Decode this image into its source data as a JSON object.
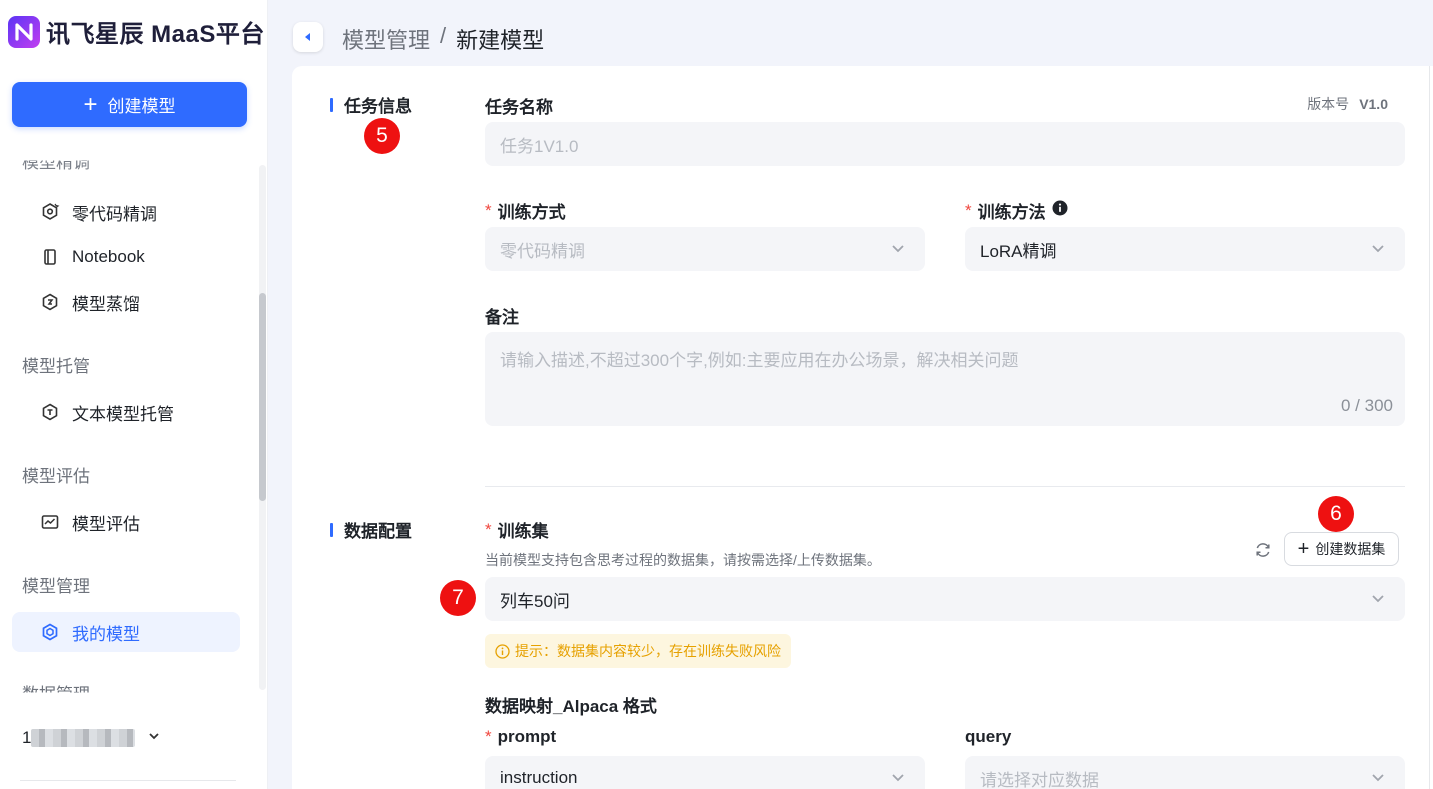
{
  "app": {
    "title": "讯飞星辰 MaaS平台"
  },
  "sidebar": {
    "create_button": "创建模型",
    "cut_group": "模型精调",
    "groups": [
      {
        "label": "模型托管"
      },
      {
        "label": "模型评估"
      },
      {
        "label": "模型管理"
      }
    ],
    "items": [
      {
        "label": "零代码精调",
        "icon": "zero-code-finetune-icon"
      },
      {
        "label": "Notebook",
        "icon": "notebook-icon"
      },
      {
        "label": "模型蒸馏",
        "icon": "distill-icon"
      },
      {
        "label": "文本模型托管",
        "icon": "hosting-icon"
      },
      {
        "label": "模型评估",
        "icon": "evaluation-icon"
      },
      {
        "label": "我的模型",
        "icon": "my-model-icon",
        "active": true
      }
    ],
    "cut_group_bottom": "数据管理",
    "user": {
      "name_prefix": "1",
      "expand_icon": "chevron-down-icon"
    }
  },
  "header": {
    "breadcrumb": [
      "模型管理",
      "/",
      "新建模型"
    ]
  },
  "task_info": {
    "section_title": "任务信息",
    "task_name_label": "任务名称",
    "task_name_value": "任务1V1.0",
    "version_label": "版本号",
    "version_value": "V1.0",
    "train_mode_label": "训练方式",
    "train_mode_value": "零代码精调",
    "train_method_label": "训练方法",
    "train_method_value": "LoRA精调",
    "remark_label": "备注",
    "remark_placeholder": "请输入描述,不超过300个字,例如:主要应用在办公场景，解决相关问题",
    "remark_counter": "0 / 300"
  },
  "data_config": {
    "section_title": "数据配置",
    "train_set_label": "训练集",
    "hint": "当前模型支持包含思考过程的数据集，请按需选择/上传数据集。",
    "create_dataset_button": "创建数据集",
    "train_set_value": "列车50问",
    "warning": "提示：数据集内容较少，存在训练失败风险",
    "mapping_title": "数据映射_Alpaca 格式",
    "prompt_label": "prompt",
    "prompt_value": "instruction",
    "query_label": "query",
    "query_placeholder": "请选择对应数据"
  },
  "badges": {
    "b5": "5",
    "b6": "6",
    "b7": "7"
  },
  "colors": {
    "accent": "#2f6bff",
    "required": "#f0473f",
    "warning": "#e6a100",
    "badge": "#ee1111"
  }
}
